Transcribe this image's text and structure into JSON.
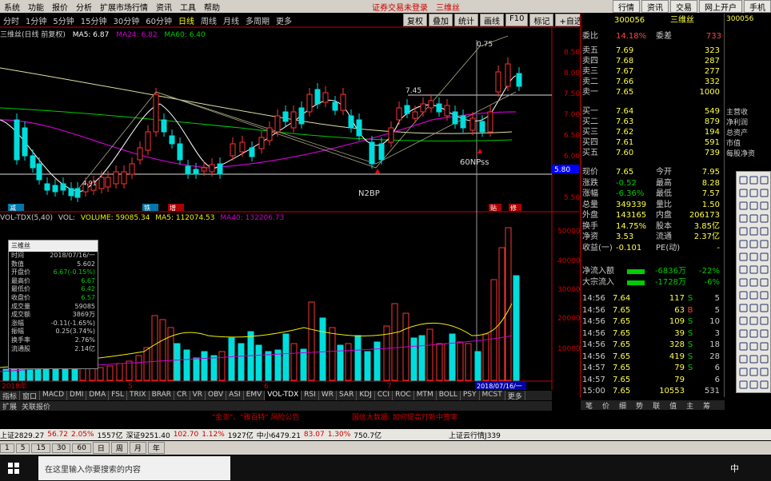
{
  "menubar": {
    "items": [
      "系统",
      "功能",
      "报价",
      "分析",
      "扩展市场行情",
      "资讯",
      "工具",
      "帮助"
    ],
    "notice": "证券交易未登录",
    "stock_name": "三维丝",
    "right_buttons": [
      "行情",
      "资讯",
      "交易",
      "网上开户",
      "手机"
    ]
  },
  "timeframes": [
    "分时",
    "1分钟",
    "5分钟",
    "15分钟",
    "30分钟",
    "60分钟",
    "日线",
    "周线",
    "月线",
    "多周期",
    "更多"
  ],
  "active_timeframe": "日线",
  "tools": [
    "复权",
    "叠加",
    "统计",
    "画线",
    "F10",
    "标记",
    "+自选",
    "返回"
  ],
  "legend_main": {
    "name": "三维丝(日线 前复权)",
    "ma5": "MA5: 6.87",
    "ma24": "MA24: 6.82",
    "ma60": "MA60: 6.40"
  },
  "annotations": {
    "hi": "0.75",
    "lvl": "7.45",
    "low": "4.91",
    "n2bp": "N2BP",
    "sixty": "60NPss",
    "jian": "减",
    "tie": "铁",
    "bian": "贴",
    "zeng": "增",
    "xiu": "修",
    "price_tag": "5.80"
  },
  "price_axis": [
    "8.50",
    "8.00",
    "7.50",
    "7.00",
    "6.50",
    "6.00",
    "5.50"
  ],
  "legend_vol": {
    "name": "VOL-TDX(5,40)",
    "vol": "VOL: ",
    "volume": "VOLUME: 59085.34",
    "ma5": "MA5: 112074.53",
    "ma40": "MA40: 132206.73"
  },
  "vol_axis": [
    "50000",
    "40000",
    "30000",
    "20000",
    "10000"
  ],
  "infobox": {
    "title": "三维丝",
    "rows": [
      {
        "k": "时间",
        "v": "2018/07/16/一"
      },
      {
        "k": "数值",
        "v": "5.602"
      },
      {
        "k": "开盘价",
        "v": "6.67(-0.15%)"
      },
      {
        "k": "最高价",
        "v": "6.67"
      },
      {
        "k": "最低价",
        "v": "6.42"
      },
      {
        "k": "收盘价",
        "v": "6.57"
      },
      {
        "k": "成交量",
        "v": "59085"
      },
      {
        "k": "成交额",
        "v": "3869万"
      },
      {
        "k": "涨幅",
        "v": "-0.11(-1.65%)"
      },
      {
        "k": "振幅",
        "v": "0.25(3.74%)"
      },
      {
        "k": "换手率",
        "v": "2.76%"
      },
      {
        "k": "流通股",
        "v": "2.14亿"
      }
    ]
  },
  "date_labels": [
    "2018年",
    "5",
    "6",
    "7"
  ],
  "date_cursor": "2018/07/16/一",
  "indicator_tabs": [
    "指标",
    "窗口",
    "MACD",
    "DMI",
    "DMA",
    "FSL",
    "TRIX",
    "BRAR",
    "CR",
    "VR",
    "OBV",
    "ASI",
    "EMV",
    "VOL-TDX",
    "RSI",
    "WR",
    "SAR",
    "KDJ",
    "CCI",
    "ROC",
    "MTM",
    "BOLL",
    "PSY",
    "MCST",
    "更多"
  ],
  "indicator_active": "VOL-TDX",
  "panel_tabs": [
    "扩展",
    "关联报价"
  ],
  "right_panel": {
    "code": "300056",
    "name": "三维丝",
    "ratio_label": "委比",
    "ratio": "14.18%",
    "diff_label": "委差",
    "diff": "733",
    "asks": [
      {
        "l": "卖五",
        "p": "7.69",
        "q": "323"
      },
      {
        "l": "卖四",
        "p": "7.68",
        "q": "287"
      },
      {
        "l": "卖三",
        "p": "7.67",
        "q": "277"
      },
      {
        "l": "卖二",
        "p": "7.66",
        "q": "332"
      },
      {
        "l": "卖一",
        "p": "7.65",
        "q": "1000"
      }
    ],
    "bids": [
      {
        "l": "买一",
        "p": "7.64",
        "q": "549"
      },
      {
        "l": "买二",
        "p": "7.63",
        "q": "879"
      },
      {
        "l": "买三",
        "p": "7.62",
        "q": "194"
      },
      {
        "l": "买四",
        "p": "7.61",
        "q": "591"
      },
      {
        "l": "买五",
        "p": "7.60",
        "q": "739"
      }
    ],
    "stats": [
      {
        "a": "现价",
        "b": "7.65",
        "c": "今开",
        "d": "7.95"
      },
      {
        "a": "涨跌",
        "b": "-0.52",
        "c": "最高",
        "d": "8.28"
      },
      {
        "a": "涨幅",
        "b": "-6.36%",
        "c": "最低",
        "d": "7.57"
      },
      {
        "a": "总量",
        "b": "349339",
        "c": "量比",
        "d": "1.50"
      },
      {
        "a": "外盘",
        "b": "143165",
        "c": "内盘",
        "d": "206173"
      },
      {
        "a": "换手",
        "b": "14.75%",
        "c": "股本",
        "d": "3.85亿"
      },
      {
        "a": "净资",
        "b": "3.53",
        "c": "流通",
        "d": "2.37亿"
      },
      {
        "a": "收益(一)",
        "b": "-0.101",
        "c": "PE(动)",
        "d": "-"
      }
    ],
    "flow": [
      {
        "a": "净流入额",
        "b": "-6836万",
        "c": "-22%"
      },
      {
        "a": "大宗流入",
        "b": "-1728万",
        "c": "-6%"
      }
    ],
    "ticks": [
      {
        "t": "14:56",
        "p": "7.64",
        "v": "117",
        "d": "S",
        "n": "5"
      },
      {
        "t": "14:56",
        "p": "7.65",
        "v": "63",
        "d": "B",
        "n": "5"
      },
      {
        "t": "14:56",
        "p": "7.65",
        "v": "109",
        "d": "S",
        "n": "10"
      },
      {
        "t": "14:56",
        "p": "7.65",
        "v": "39",
        "d": "S",
        "n": "3"
      },
      {
        "t": "14:56",
        "p": "7.65",
        "v": "328",
        "d": "S",
        "n": "18"
      },
      {
        "t": "14:56",
        "p": "7.65",
        "v": "419",
        "d": "S",
        "n": "28"
      },
      {
        "t": "14:57",
        "p": "7.65",
        "v": "79",
        "d": "S",
        "n": "6"
      },
      {
        "t": "14:57",
        "p": "7.65",
        "v": "79",
        "d": "",
        "n": "6"
      },
      {
        "t": "15:00",
        "p": "7.65",
        "v": "10553",
        "d": "",
        "n": "531"
      }
    ],
    "tabs": [
      "笔",
      "价",
      "细",
      "势",
      "联",
      "值",
      "主",
      "筹"
    ]
  },
  "far": {
    "code": "300056",
    "name": "三维丝",
    "labels": [
      "主营收",
      "净利润",
      "总资产",
      "市值",
      "每股净资"
    ]
  },
  "status": {
    "left": "\"金亚\"、\"雅百特\" 风险公告",
    "right": "国信大数据: 如何提高打新中签率"
  },
  "index_bar": {
    "sh": "上证2829.27",
    "sh_chg": "56.72",
    "sh_pct": "2.05%",
    "sh_amt": "1557亿",
    "sz": "深证9251.40",
    "sz_chg": "102.70",
    "sz_pct": "1.12%",
    "sz_amt": "1927亿",
    "zx": "中小6479.21",
    "zx_chg": "83.07",
    "zx_pct": "1.30%",
    "zx_amt": "750.7亿",
    "cloud": "上证云行情J339"
  },
  "ctrl": [
    "1",
    "5",
    "15",
    "30",
    "60",
    "日",
    "周",
    "月",
    "年"
  ],
  "taskbar": {
    "search": "在这里输入你要搜索的内容",
    "ime": "中"
  }
}
